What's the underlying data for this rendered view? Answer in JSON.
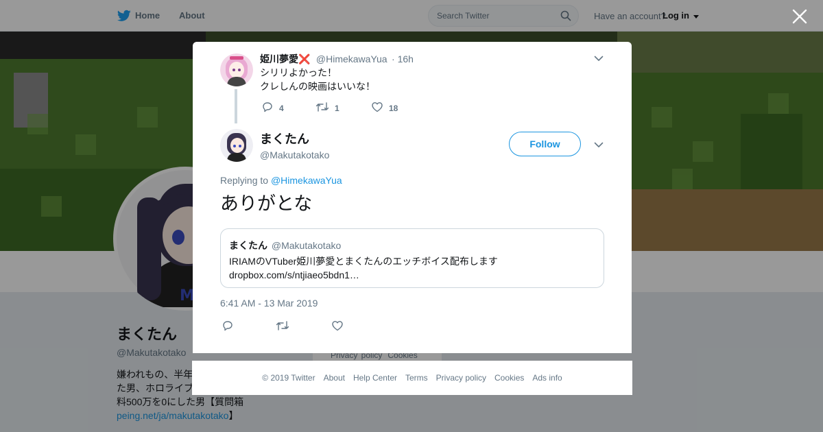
{
  "topnav": {
    "home_label": "Home",
    "about_label": "About",
    "search_placeholder": "Search Twitter",
    "account_prompt": "Have an account?",
    "login_label": "Log in"
  },
  "background_profile": {
    "name": "まくたん",
    "handle": "@Makutakotako",
    "bio_lines": [
      "嫌われもの、半年",
      "た男、ホロライブ",
      "料500万を0にした男【質問箱"
    ],
    "bio_link": "peing.net/ja/makutakotako",
    "bio_link_suffix": "】",
    "mini_footer": [
      "Privacy policy",
      "Cookies"
    ]
  },
  "modal": {
    "parent_tweet": {
      "name": "姫川夢愛",
      "name_emoji": "❌",
      "handle": "@HimekawaYua",
      "time": "· 16h",
      "text_lines": [
        "シリリよかった！",
        "クレしんの映画はいいな！"
      ],
      "reply_count": "4",
      "retweet_count": "1",
      "like_count": "18"
    },
    "main_tweet": {
      "name": "まくたん",
      "handle": "@Makutakotako",
      "follow_label": "Follow",
      "replying_prefix": "Replying to",
      "replying_handle": "@HimekawaYua",
      "text": "ありがとな",
      "timestamp": "6:41 AM - 13 Mar 2019",
      "quote": {
        "name": "まくたん",
        "handle": "@Makutakotako",
        "text": "IRIAMのVTuber姫川夢愛とまくたんのエッチボイス配布します",
        "link": "dropbox.com/s/ntjiaeo5bdn1…"
      }
    }
  },
  "footer": {
    "copyright": "© 2019 Twitter",
    "links": [
      "About",
      "Help Center",
      "Terms",
      "Privacy policy",
      "Cookies",
      "Ads info"
    ]
  },
  "colors": {
    "accent": "#1b95e0",
    "muted": "#657786",
    "background": "#e6ecf0"
  },
  "icons": [
    "twitter-bird-icon",
    "search-icon",
    "close-icon",
    "chevron-down-icon",
    "reply-icon",
    "retweet-icon",
    "like-icon",
    "caret-down-icon"
  ]
}
